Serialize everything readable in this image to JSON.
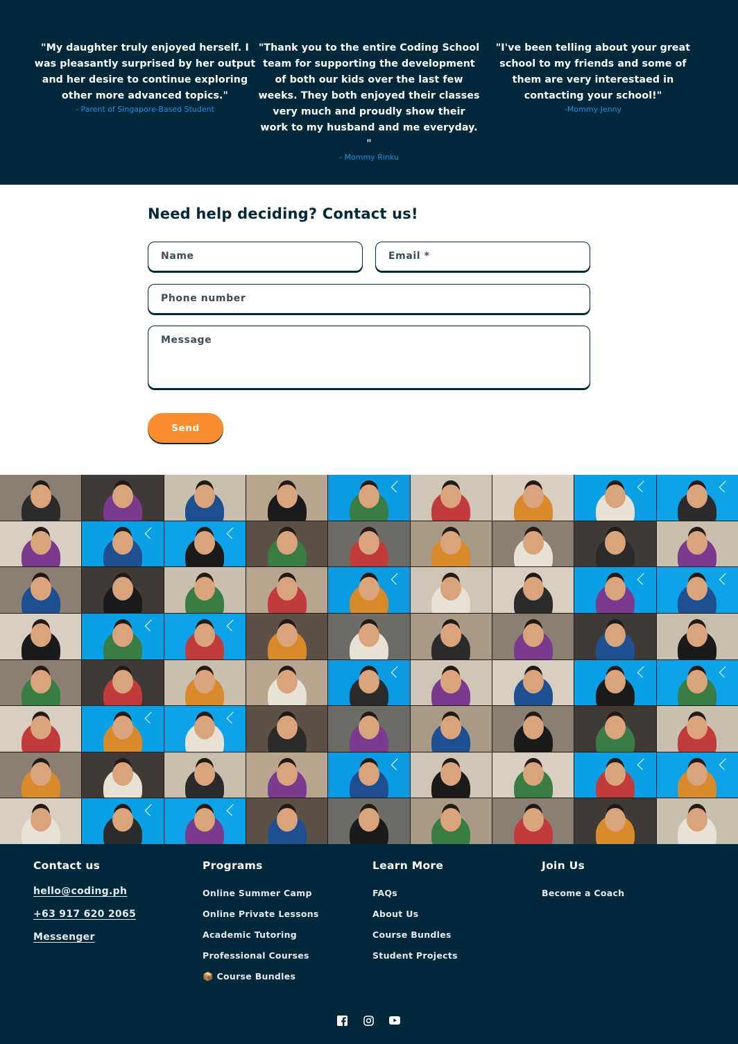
{
  "testimonials": [
    {
      "quote": "\"My daughter truly enjoyed herself. I was pleasantly surprised by her output and her desire to continue exploring other more advanced topics.\"",
      "author": "- Parent of Singapore-Based Student"
    },
    {
      "quote": "\"Thank you to the entire Coding School team for supporting the development of both our kids over the last few weeks. They both enjoyed their classes very much and proudly show their work to my husband and me everyday. \"",
      "author": "- Mommy Rinku"
    },
    {
      "quote": "\"I've been telling about your great school to my friends and some of them are very interestaed in contacting your school!\"",
      "author": "-Mommy Jenny"
    }
  ],
  "contact_form": {
    "title": "Need help deciding? Contact us!",
    "name_placeholder": "Name",
    "email_placeholder": "Email *",
    "phone_placeholder": "Phone number",
    "message_placeholder": "Message",
    "send_label": "Send"
  },
  "footer": {
    "contact": {
      "heading": "Contact us",
      "email": "hello@coding.ph",
      "phone": "+63 917 620 2065",
      "messenger": "Messenger"
    },
    "programs": {
      "heading": "Programs",
      "items": [
        "Online Summer Camp",
        "Online Private Lessons",
        "Academic Tutoring",
        "Professional Courses",
        "📦 Course Bundles"
      ]
    },
    "learn_more": {
      "heading": "Learn More",
      "items": [
        "FAQs",
        "About Us",
        "Course Bundles",
        "Student Projects"
      ]
    },
    "join_us": {
      "heading": "Join Us",
      "items": [
        "Become a Coach"
      ]
    },
    "social": [
      "facebook-icon",
      "instagram-icon",
      "youtube-icon"
    ]
  },
  "colors": {
    "navy": "#02283c",
    "accent_blue": "#1f8fe0",
    "send_orange": "#f98c2c"
  }
}
